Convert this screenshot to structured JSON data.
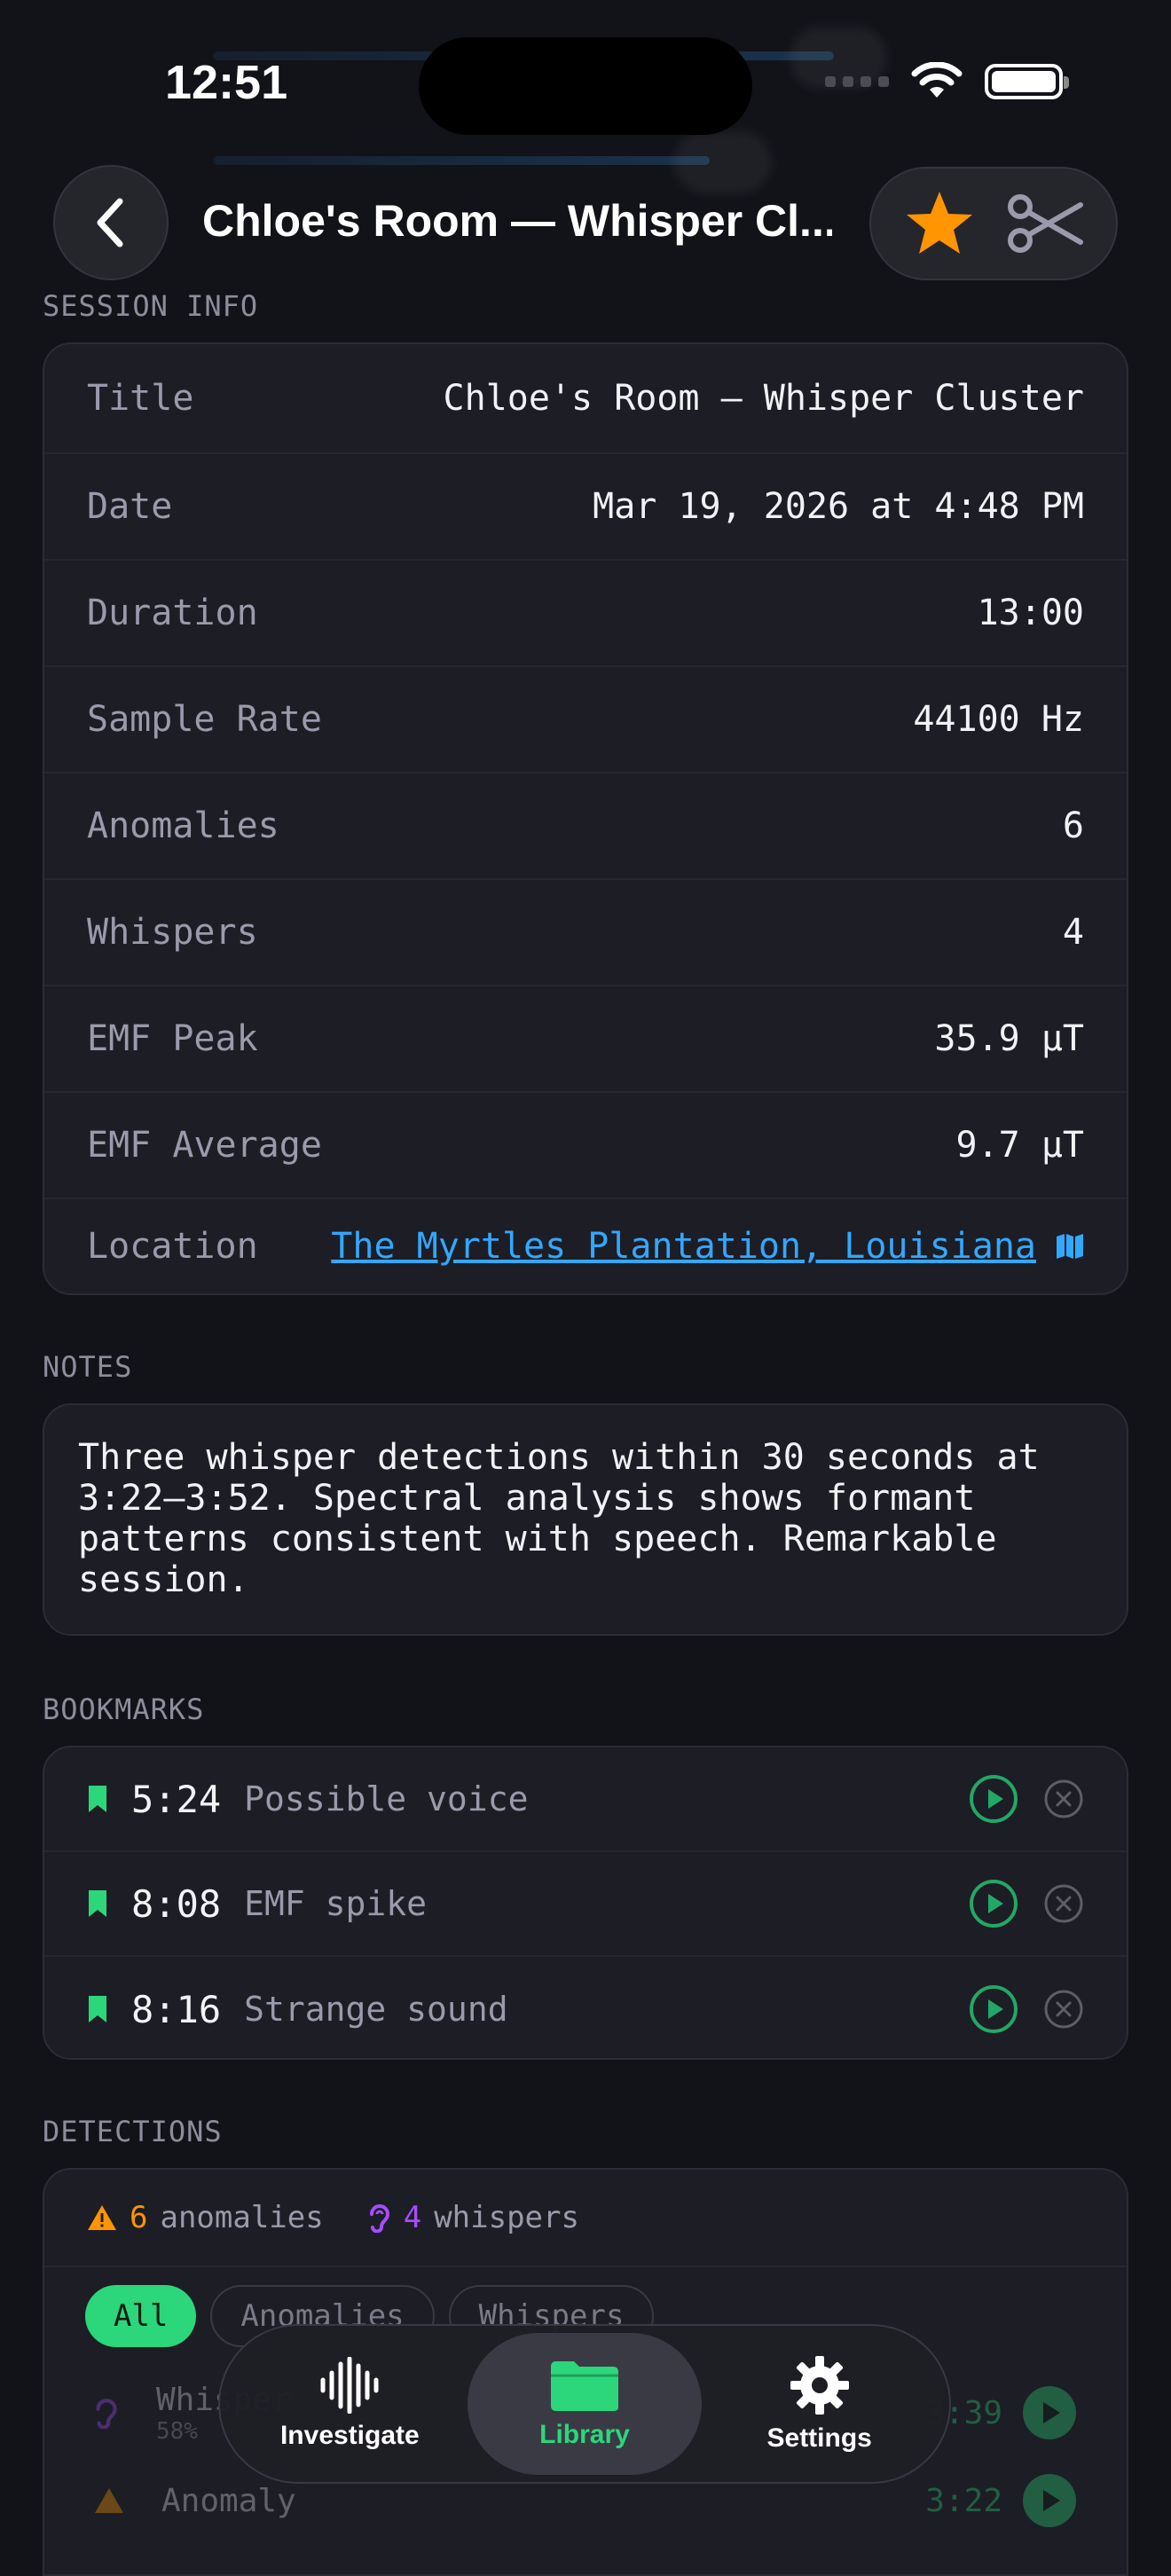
{
  "status_bar": {
    "time": "12:51"
  },
  "header": {
    "title": "Chloe's Room — Whisper Cl..."
  },
  "session_info": {
    "section_label": "SESSION INFO",
    "rows": [
      {
        "label": "Title",
        "value": "Chloe's Room — Whisper Cluster"
      },
      {
        "label": "Date",
        "value": "Mar 19, 2026 at 4:48 PM"
      },
      {
        "label": "Duration",
        "value": "13:00"
      },
      {
        "label": "Sample Rate",
        "value": "44100 Hz"
      },
      {
        "label": "Anomalies",
        "value": "6"
      },
      {
        "label": "Whispers",
        "value": "4"
      },
      {
        "label": "EMF Peak",
        "value": "35.9 µT"
      },
      {
        "label": "EMF Average",
        "value": "9.7 µT"
      },
      {
        "label": "Location",
        "value": "The Myrtles Plantation, Louisiana"
      }
    ]
  },
  "notes": {
    "section_label": "NOTES",
    "text": "Three whisper detections within 30 seconds at 3:22–3:52. Spectral analysis shows formant patterns consistent with speech. Remarkable session."
  },
  "bookmarks": {
    "section_label": "BOOKMARKS",
    "items": [
      {
        "time": "5:24",
        "label": "Possible voice"
      },
      {
        "time": "8:08",
        "label": "EMF spike"
      },
      {
        "time": "8:16",
        "label": "Strange sound"
      }
    ]
  },
  "detections": {
    "section_label": "DETECTIONS",
    "anomaly_count": "6",
    "anomaly_word": "anomalies",
    "whisper_count": "4",
    "whisper_word": "whispers",
    "filters": [
      "All",
      "Anomalies",
      "Whispers"
    ],
    "items": [
      {
        "type": "Whisper",
        "confidence": "58%",
        "time": "3:39"
      },
      {
        "type": "Anomaly",
        "time": "3:22"
      }
    ]
  },
  "tab_bar": {
    "tabs": [
      {
        "label": "Investigate"
      },
      {
        "label": "Library"
      },
      {
        "label": "Settings"
      }
    ]
  },
  "colors": {
    "accent_green": "#2bd77a",
    "link_blue": "#32a8ff",
    "star_orange": "#ff9500",
    "whisper_purple": "#a64dff"
  }
}
